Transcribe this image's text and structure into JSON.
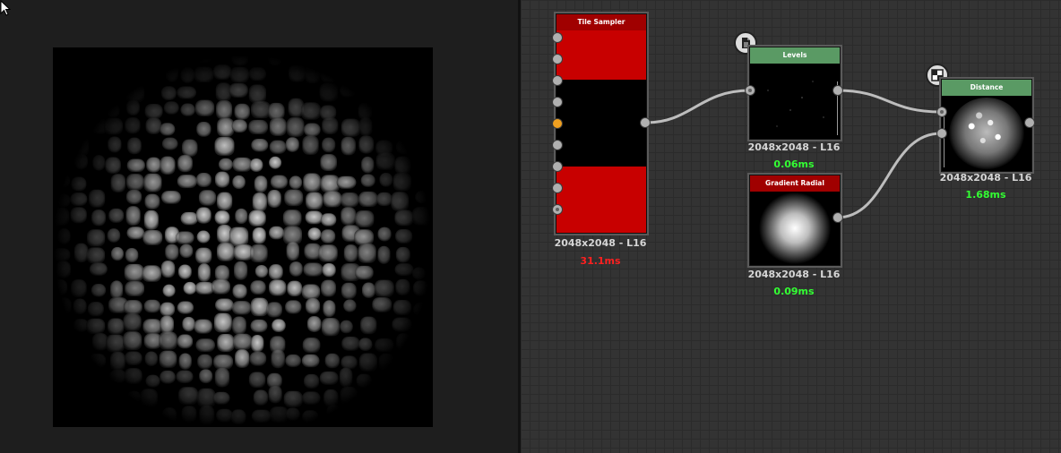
{
  "nodes": {
    "tile_sampler": {
      "title": "Tile Sampler",
      "resolution": "2048x2048 - L16",
      "time": "31.1ms",
      "time_color": "#ff2020"
    },
    "levels": {
      "title": "Levels",
      "resolution": "2048x2048 - L16",
      "time": "0.06ms",
      "time_color": "#33ff33"
    },
    "gradient_radial": {
      "title": "Gradient Radial",
      "resolution": "2048x2048 - L16",
      "time": "0.09ms",
      "time_color": "#33ff33"
    },
    "distance": {
      "title": "Distance",
      "resolution": "2048x2048 - L16",
      "time": "1.68ms",
      "time_color": "#33ff33"
    }
  },
  "colors": {
    "tile_sampler_header": "#a00000",
    "tile_sampler_body": "#c80000",
    "filter_header": "#5a9a64",
    "input_port_active": "#f0a020"
  },
  "icons": {
    "levels_badge": "document-icon",
    "distance_badge": "checker-icon"
  }
}
